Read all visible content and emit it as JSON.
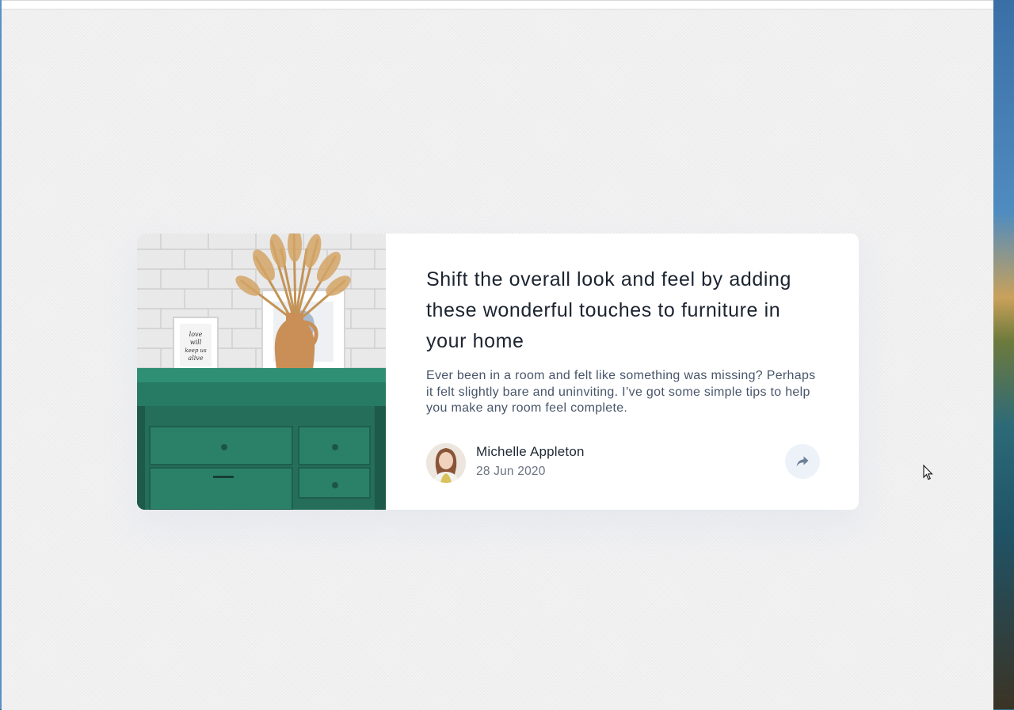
{
  "article": {
    "title": "Shift the overall look and feel by adding these wonderful touches to furniture in your home",
    "description": "Ever been in a room and felt like something was missing? Perhaps it felt slightly bare and uninviting. I’ve got some simple tips to help you make any room feel complete.",
    "image": {
      "frame_text": "love will keep us alive"
    },
    "author": {
      "name": "Michelle Appleton",
      "date": "28 Jun 2020"
    },
    "share_icon": "share-icon"
  },
  "colors": {
    "heading": "#48556a",
    "text": "#6e8098",
    "share_bg": "#ecf2f8",
    "dresser": "#2f7a62"
  }
}
